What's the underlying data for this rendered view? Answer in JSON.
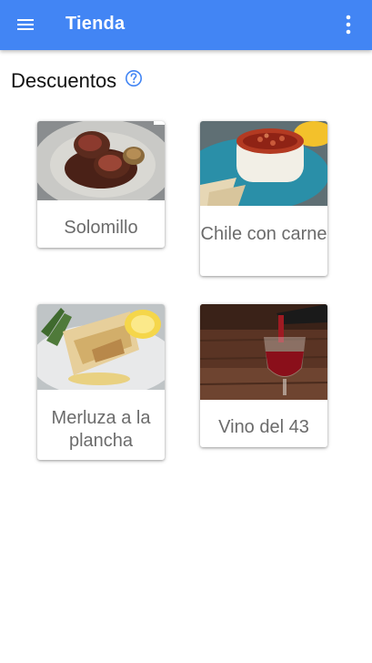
{
  "app": {
    "title": "Tienda"
  },
  "section": {
    "title": "Descuentos"
  },
  "products": [
    {
      "name": "Solomillo",
      "image": "steak-dish"
    },
    {
      "name": "Chile con carne",
      "image": "chili-bowl"
    },
    {
      "name": "Merluza a la plancha",
      "image": "grilled-fish"
    },
    {
      "name": "Vino del 43",
      "image": "red-wine-glass"
    }
  ],
  "icons": {
    "menu": "menu-icon",
    "more": "more-vert-icon",
    "help": "help-icon"
  },
  "colors": {
    "primary": "#4285f4",
    "card_text": "#6b6b6b"
  }
}
